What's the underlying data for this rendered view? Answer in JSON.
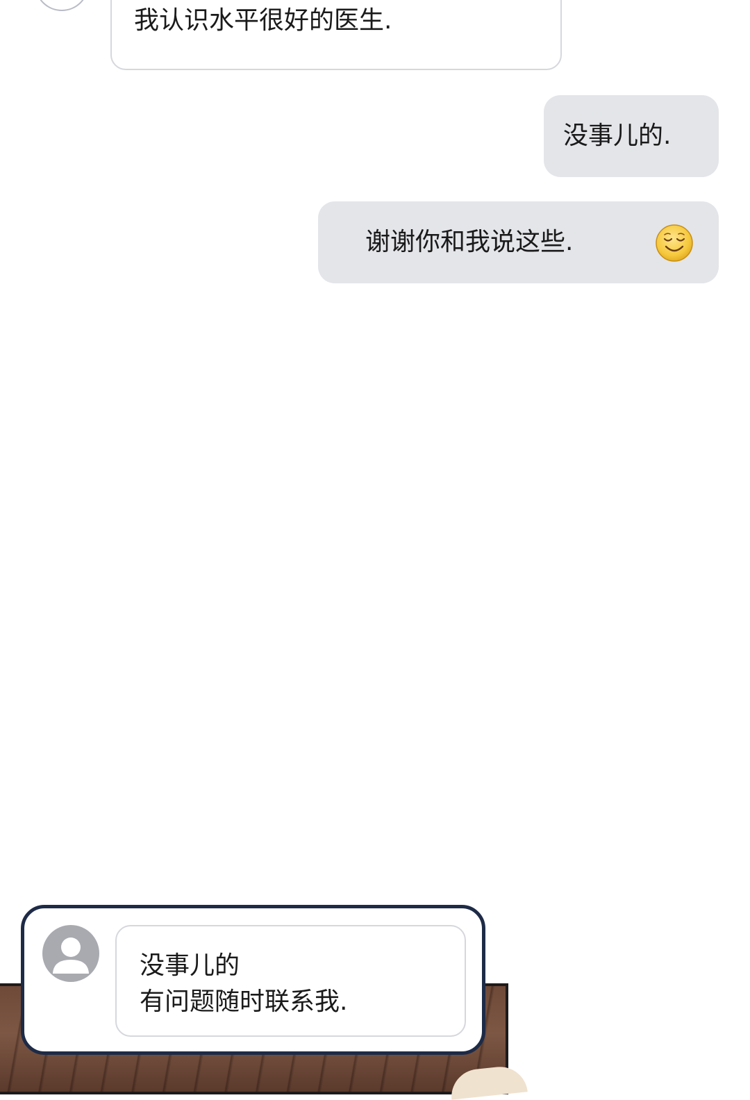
{
  "messages": {
    "incoming_top": "我认识水平很好的医生.",
    "outgoing_1": "没事儿的.",
    "outgoing_2": "谢谢你和我说这些."
  },
  "emoji": {
    "name": "smiling-face-icon",
    "color": "#f6c93e"
  },
  "notification": {
    "line1": "没事儿的",
    "line2": "有问题随时联系我."
  },
  "colors": {
    "outgoing_bubble": "#e4e5e9",
    "incoming_border": "#d6d7dc",
    "popup_border": "#1e2b47",
    "avatar_gray": "#a8aab0"
  }
}
